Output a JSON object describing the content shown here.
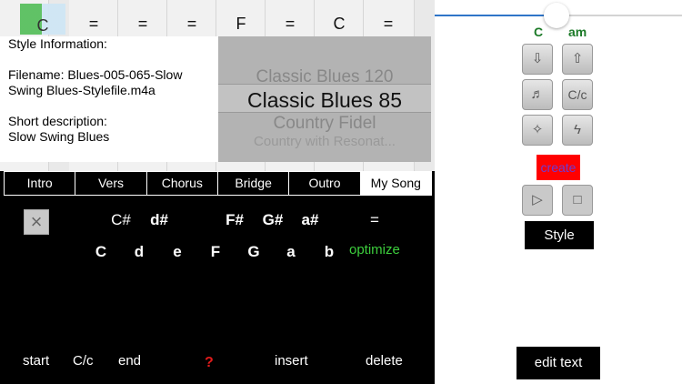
{
  "grid": {
    "cells": [
      "C",
      "=",
      "=",
      "=",
      "F",
      "=",
      "C",
      "="
    ]
  },
  "style_info": {
    "heading": "Style Information:",
    "filename": "Filename: Blues-005-065-Slow Swing Blues-Stylefile.m4a",
    "desc_label": "Short description:",
    "desc": "Slow Swing Blues"
  },
  "picker": {
    "items": [
      "Classic Blues 120",
      "Classic Blues 85",
      "Country Fidel",
      "Country with Resonat..."
    ],
    "selected": "Classic Blues 85"
  },
  "tabs": [
    "Intro",
    "Vers",
    "Chorus",
    "Bridge",
    "Outro",
    "My Song"
  ],
  "chords": {
    "sharps": [
      "C#",
      "d#",
      "F#",
      "G#",
      "a#",
      "="
    ],
    "naturals": [
      "C",
      "d",
      "e",
      "F",
      "G",
      "a",
      "b"
    ],
    "optimize": "optimize",
    "close_icon": "×"
  },
  "bottom": {
    "start": "start",
    "cc": "C/c",
    "end": "end",
    "help": "?",
    "insert": "insert",
    "delete": "delete"
  },
  "right": {
    "key_major": "C",
    "key_minor": "am",
    "cc_label": "C/c",
    "create": "create",
    "style": "Style",
    "edit_text": "edit text",
    "slider_value": 0.5,
    "colors": {
      "accent": "#2f75c8",
      "key": "#1c7a28",
      "create_bg": "#ff0000",
      "create_fg": "#6a3bd6",
      "optimize": "#3ccd3c"
    }
  }
}
